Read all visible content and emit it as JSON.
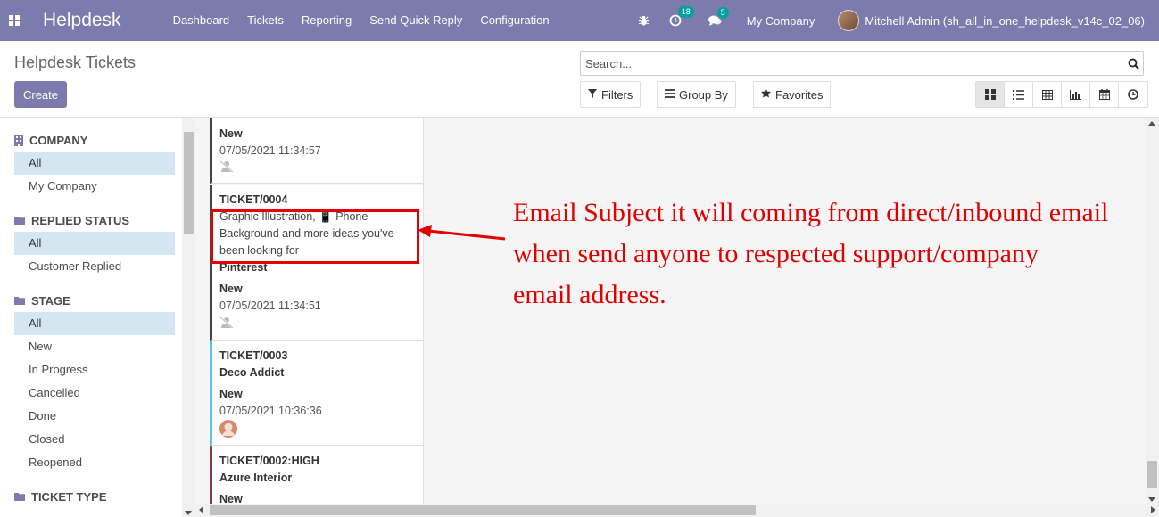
{
  "navbar": {
    "brand": "Helpdesk",
    "menu": [
      "Dashboard",
      "Tickets",
      "Reporting",
      "Send Quick Reply",
      "Configuration"
    ],
    "activity_count": "18",
    "message_count": "5",
    "company": "My Company",
    "user": "Mitchell Admin (sh_all_in_one_helpdesk_v14c_02_06)",
    "color": "#7c7bad"
  },
  "control": {
    "title": "Helpdesk Tickets",
    "create_label": "Create",
    "search_placeholder": "Search...",
    "filters_label": "Filters",
    "groupby_label": "Group By",
    "favorites_label": "Favorites",
    "views": [
      "kanban-icon",
      "list-icon",
      "pivot-icon",
      "graph-icon",
      "calendar-icon",
      "activity-icon"
    ],
    "active_view": "kanban-icon"
  },
  "sidebar": {
    "sections": [
      {
        "title": "COMPANY",
        "icon": "building-icon",
        "items": [
          "All",
          "My Company"
        ],
        "active": 0
      },
      {
        "title": "REPLIED STATUS",
        "icon": "folder-icon",
        "items": [
          "All",
          "Customer Replied"
        ],
        "active": 0
      },
      {
        "title": "STAGE",
        "icon": "folder-icon",
        "items": [
          "All",
          "New",
          "In Progress",
          "Cancelled",
          "Done",
          "Closed",
          "Reopened"
        ],
        "active": 0
      },
      {
        "title": "TICKET TYPE",
        "icon": "folder-icon",
        "items": [],
        "active": -1
      }
    ]
  },
  "cards": [
    {
      "stage": "New",
      "date": "07/05/2021 11:34:57",
      "accent": "#444444"
    },
    {
      "ref": "TICKET/0004",
      "subject": "Graphic Illustration, 📱 Phone Background and more ideas you've been looking for",
      "partner": "Pinterest",
      "stage": "New",
      "date": "07/05/2021 11:34:51",
      "accent": "#444444"
    },
    {
      "ref": "TICKET/0003",
      "partner": "Deco Addict",
      "stage": "New",
      "date": "07/05/2021 10:36:36",
      "accent": "#5bc0de"
    },
    {
      "ref": "TICKET/0002:HIGH",
      "partner": "Azure Interior",
      "stage": "New",
      "accent": "#8b3a4a"
    }
  ],
  "annotation": {
    "lines": [
      "Email Subject it will coming from direct/inbound email",
      "when send anyone to respected support/company",
      "email address."
    ],
    "color": "#e00000"
  }
}
